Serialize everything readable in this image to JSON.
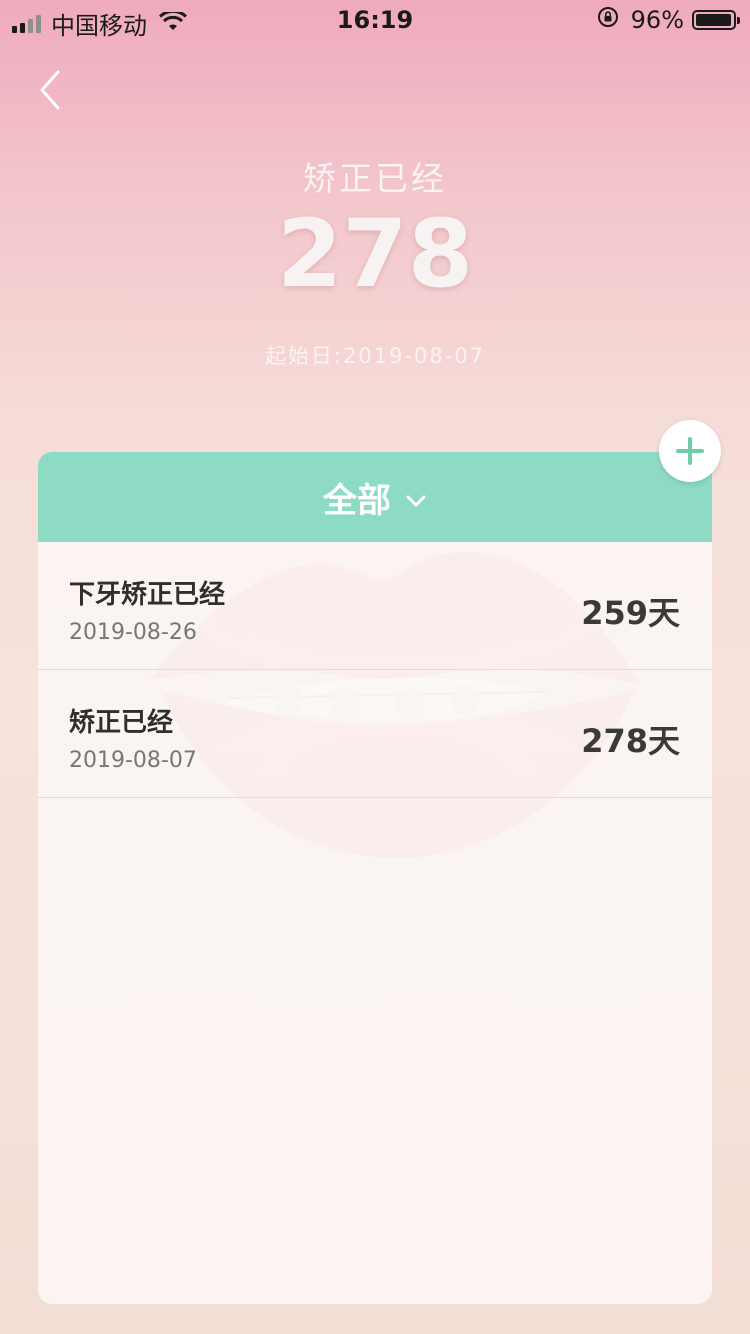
{
  "status_bar": {
    "carrier": "中国移动",
    "time": "16:19",
    "battery": "96%",
    "battery_level": 0.96
  },
  "header": {
    "title": "矫正已经",
    "count": "278",
    "start_date": "起始日:2019-08-07"
  },
  "filter": {
    "label": "全部"
  },
  "records": [
    {
      "title": "下牙矫正已经",
      "date": "2019-08-26",
      "days": "259天"
    },
    {
      "title": "矫正已经",
      "date": "2019-08-07",
      "days": "278天"
    }
  ],
  "colors": {
    "accent": "#8edbc5",
    "add_icon": "#6fcda8"
  },
  "icons": {
    "back": "chevron-left-icon",
    "dropdown": "chevron-down-icon",
    "add": "plus-icon",
    "wifi": "wifi-icon",
    "rotation_lock": "rotation-lock-icon"
  }
}
